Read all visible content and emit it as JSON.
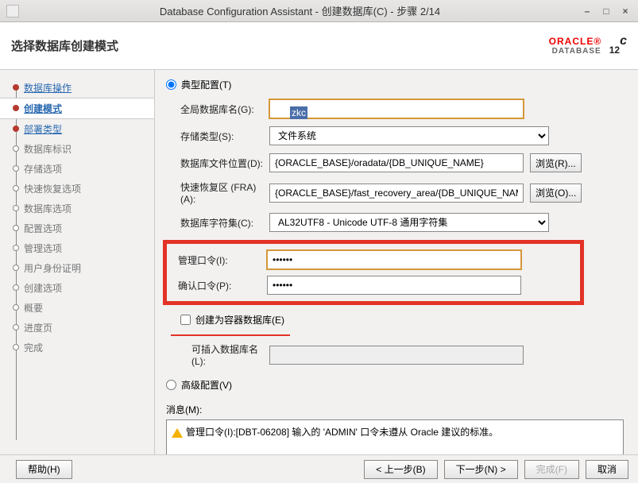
{
  "window": {
    "title": "Database Configuration Assistant - 创建数据库(C) - 步骤 2/14"
  },
  "header": {
    "title": "选择数据库创建模式",
    "brand": "ORACLE",
    "brand_sub": "DATABASE",
    "version": "12",
    "version_suffix": "c"
  },
  "sidebar": {
    "steps": [
      {
        "label": "数据库操作",
        "state": "completed"
      },
      {
        "label": "创建模式",
        "state": "current"
      },
      {
        "label": "部署类型",
        "state": "completed"
      },
      {
        "label": "数据库标识",
        "state": "pending"
      },
      {
        "label": "存储选项",
        "state": "pending"
      },
      {
        "label": "快速恢复选项",
        "state": "pending"
      },
      {
        "label": "数据库选项",
        "state": "pending"
      },
      {
        "label": "配置选项",
        "state": "pending"
      },
      {
        "label": "管理选项",
        "state": "pending"
      },
      {
        "label": "用户身份证明",
        "state": "pending"
      },
      {
        "label": "创建选项",
        "state": "pending"
      },
      {
        "label": "概要",
        "state": "pending"
      },
      {
        "label": "进度页",
        "state": "pending"
      },
      {
        "label": "完成",
        "state": "pending"
      }
    ]
  },
  "config": {
    "mode_typical": "典型配置(T)",
    "mode_advanced": "高级配置(V)",
    "labels": {
      "global_db_name": "全局数据库名(G):",
      "storage_type": "存储类型(S):",
      "db_file_location": "数据库文件位置(D):",
      "fra": "快速恢复区 (FRA)(A):",
      "charset": "数据库字符集(C):",
      "admin_pwd": "管理口令(I):",
      "confirm_pwd": "确认口令(P):",
      "cdb_check": "创建为容器数据库(E)",
      "pdb_name": "可插入数据库名(L):"
    },
    "values": {
      "global_db_name": "zkc",
      "storage_type": "文件系统",
      "db_file_location": "{ORACLE_BASE}/oradata/{DB_UNIQUE_NAME}",
      "fra": "{ORACLE_BASE}/fast_recovery_area/{DB_UNIQUE_NAME}",
      "charset": "AL32UTF8 - Unicode UTF-8 通用字符集",
      "admin_pwd": "••••••",
      "confirm_pwd": "••••••",
      "pdb_name": ""
    },
    "browse": "浏览(R)...",
    "browse2": "浏览(O)..."
  },
  "messages": {
    "label": "消息(M):",
    "text": "管理口令(I):[DBT-06208] 输入的 'ADMIN' 口令未遵从 Oracle 建议的标准。"
  },
  "footer": {
    "help": "帮助(H)",
    "back": "< 上一步(B)",
    "next": "下一步(N) >",
    "finish": "完成(F)",
    "cancel": "取消"
  }
}
